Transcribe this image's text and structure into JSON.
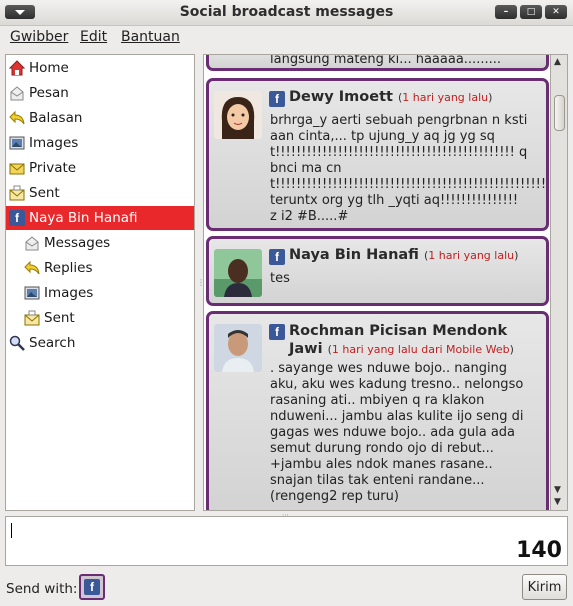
{
  "window": {
    "title": "Social broadcast messages"
  },
  "menubar": {
    "items": [
      "Gwibber",
      "Edit",
      "Bantuan"
    ]
  },
  "sidebar": {
    "items": [
      {
        "label": "Home",
        "icon": "home-icon"
      },
      {
        "label": "Pesan",
        "icon": "message-icon"
      },
      {
        "label": "Balasan",
        "icon": "reply-icon"
      },
      {
        "label": "Images",
        "icon": "image-icon"
      },
      {
        "label": "Private",
        "icon": "private-icon"
      },
      {
        "label": "Sent",
        "icon": "sent-icon"
      },
      {
        "label": "Naya Bin Hanafi",
        "icon": "facebook-icon",
        "selected": true
      },
      {
        "label": "Messages",
        "icon": "message-icon",
        "indent": true
      },
      {
        "label": "Replies",
        "icon": "reply-icon",
        "indent": true
      },
      {
        "label": "Images",
        "icon": "image-icon",
        "indent": true
      },
      {
        "label": "Sent",
        "icon": "sent-icon",
        "indent": true
      },
      {
        "label": "Search",
        "icon": "search-icon"
      }
    ],
    "selected_color": "#e8282b"
  },
  "stream": {
    "partial_text": "langsung mateng ki... haaaaa.........",
    "messages": [
      {
        "name": "Dewy Imoett",
        "time": "1 hari yang lalu",
        "source": "",
        "body": "brhrga_y aerti sebuah pengrbnan n kstiaan cinta,... tp ujung_y aq jg yg sqt!!!!!!!!!!!!!!!!!!!!!!!!!!!!!!!!!!!!!!!!!!!!!! q bnci ma cnt!!!!!!!!!!!!!!!!!!!!!!!!!!!!!!!!!!!!!!!!!!!!!!!!!!!!!!!!!!!!!!!!!!!!!!!!!!!! teruntx org yg tlh _yqti aq!!!!!!!!!!!!!!! z i2 #B.....#"
      },
      {
        "name": "Naya Bin Hanafi",
        "time": "1 hari yang lalu",
        "source": "",
        "body": "tes"
      },
      {
        "name": "Rochman Picisan Mendonk Jawi",
        "time": "1 hari yang lalu",
        "source": "dari Mobile Web",
        "body": ". sayange wes nduwe bojo.. nanging aku, aku wes kadung tresno.. nelongso rasaning ati.. mbiyen q ra klakon nduweni... jambu alas kulite ijo seng di gagas wes nduwe bojo.. ada gula ada semut durung rondo ojo di rebut... +jambu ales ndok manes rasane.. snajan tilas tak enteni randane... (rengeng2 rep turu)"
      }
    ],
    "card_border_color": "#6a2c73"
  },
  "composer": {
    "counter": "140"
  },
  "footer": {
    "send_with_label": "Send with:",
    "send_button": "Kirim",
    "account_icon": "facebook-icon"
  }
}
